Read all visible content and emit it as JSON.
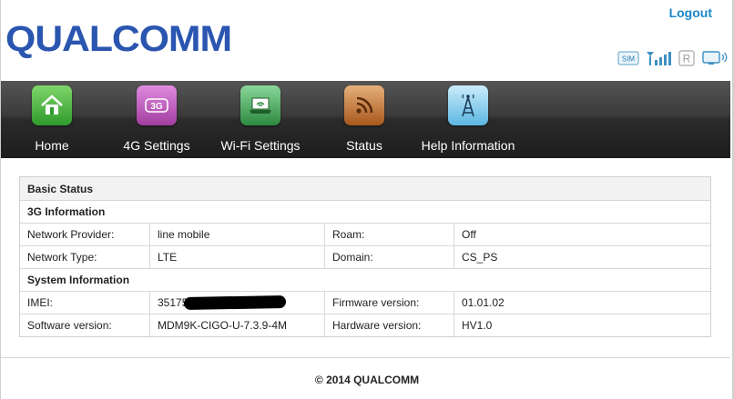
{
  "header": {
    "brand": "QUALCOMM",
    "logout_label": "Logout",
    "status_icons": [
      "sim-icon",
      "signal-strength-icon",
      "roaming-icon",
      "monitor-connection-icon"
    ],
    "roaming_glyph": "R",
    "sim_glyph": "SIM"
  },
  "nav": {
    "items": [
      {
        "label": "Home",
        "icon": "home-icon",
        "color": "#3fa83a"
      },
      {
        "label": "4G Settings",
        "icon": "3g-icon",
        "color": "#b84fb0",
        "badge": "3G"
      },
      {
        "label": "Wi-Fi Settings",
        "icon": "laptop-wifi-icon",
        "color": "#3c9a48"
      },
      {
        "label": "Status",
        "icon": "rss-icon",
        "color": "#b86a2a"
      },
      {
        "label": "Help Information",
        "icon": "antenna-icon",
        "color": "#58b4e0"
      }
    ]
  },
  "status": {
    "title": "Basic Status",
    "section_3g": "3G Information",
    "network_provider_label": "Network Provider:",
    "network_provider_value": "line mobile",
    "roam_label": "Roam:",
    "roam_value": "Off",
    "network_type_label": "Network Type:",
    "network_type_value": "LTE",
    "domain_label": "Domain:",
    "domain_value": "CS_PS",
    "section_system": "System Information",
    "imei_label": "IMEI:",
    "imei_value_visible": "35175",
    "firmware_label": "Firmware version:",
    "firmware_value": "01.01.02",
    "software_label": "Software version:",
    "software_value": "MDM9K-CIGO-U-7.3.9-4M",
    "hardware_label": "Hardware version:",
    "hardware_value": "HV1.0"
  },
  "footer": {
    "copyright": "© 2014 QUALCOMM"
  }
}
